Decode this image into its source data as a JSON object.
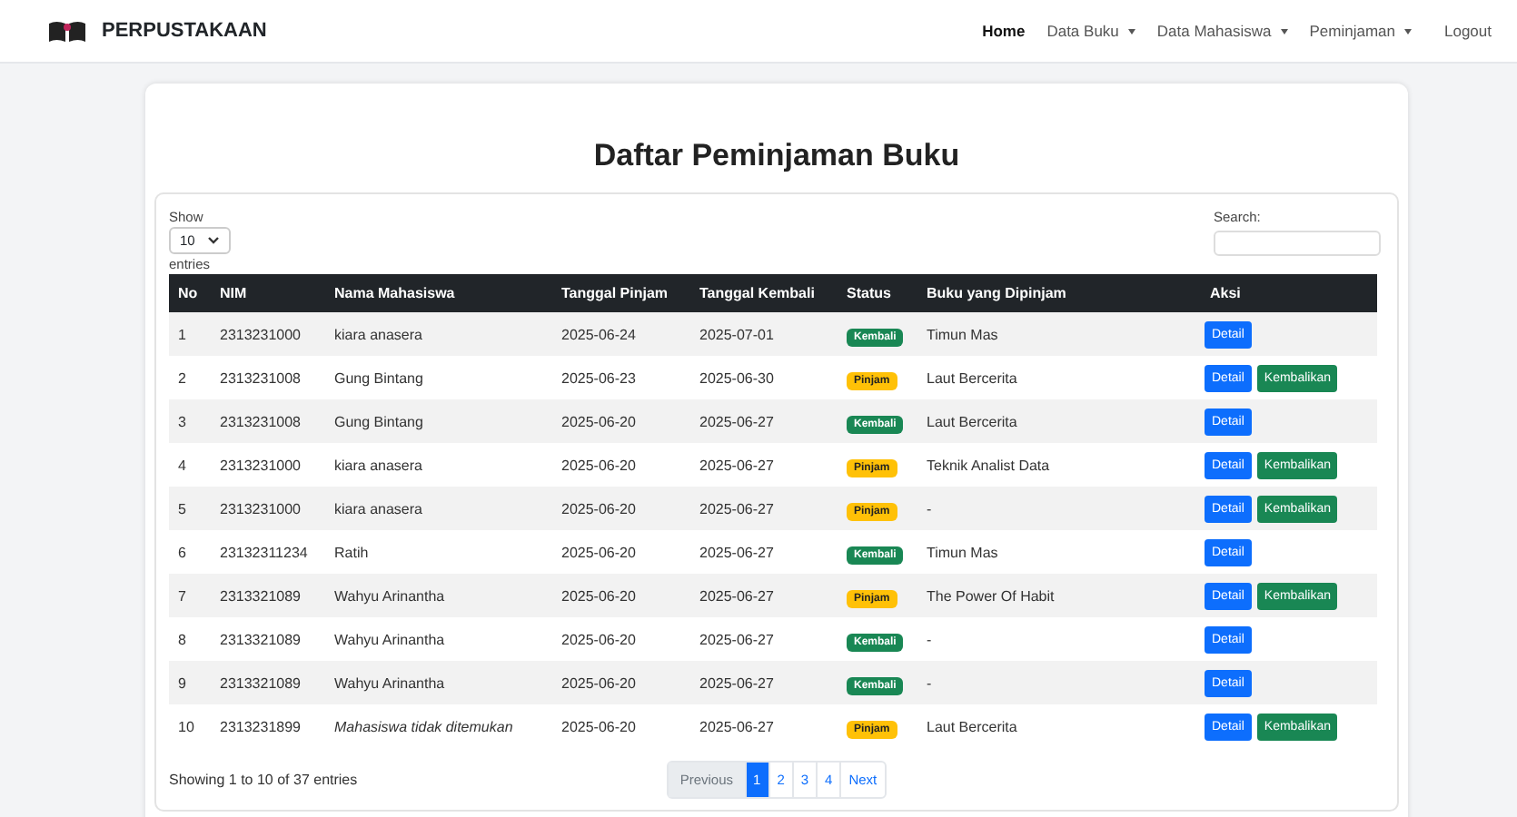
{
  "navbar": {
    "brand": "PERPUSTAKAAN",
    "items": [
      {
        "label": "Home",
        "selected": true,
        "dropdown": false
      },
      {
        "label": "Data Buku",
        "selected": false,
        "dropdown": true
      },
      {
        "label": "Data Mahasiswa",
        "selected": false,
        "dropdown": true
      },
      {
        "label": "Peminjaman",
        "selected": false,
        "dropdown": true
      },
      {
        "label": "Logout",
        "selected": false,
        "dropdown": false
      }
    ]
  },
  "title": "Daftar Peminjaman Buku",
  "length_control": {
    "label_before": "Show",
    "value": "10",
    "label_after": "entries"
  },
  "search": {
    "label": "Search:"
  },
  "table": {
    "columns": [
      "No",
      "NIM",
      "Nama Mahasiswa",
      "Tanggal Pinjam",
      "Tanggal Kembali",
      "Status",
      "Buku yang Dipinjam",
      "Aksi"
    ],
    "rows": [
      {
        "no": "1",
        "nim": "2313231000",
        "name": "kiara anasera",
        "name_found": true,
        "borrowed": "2025-06-24",
        "returned": "2025-07-01",
        "status": {
          "label": "Kembali",
          "kind": "returned"
        },
        "book": "Timun Mas",
        "actions": [
          {
            "label": "Detail",
            "kind": "detail"
          }
        ]
      },
      {
        "no": "2",
        "nim": "2313231008",
        "name": "Gung Bintang",
        "name_found": true,
        "borrowed": "2025-06-23",
        "returned": "2025-06-30",
        "status": {
          "label": "Pinjam",
          "kind": "borrowed"
        },
        "book": "Laut Bercerita",
        "actions": [
          {
            "label": "Detail",
            "kind": "detail"
          },
          {
            "label": "Kembalikan",
            "kind": "return"
          }
        ]
      },
      {
        "no": "3",
        "nim": "2313231008",
        "name": "Gung Bintang",
        "name_found": true,
        "borrowed": "2025-06-20",
        "returned": "2025-06-27",
        "status": {
          "label": "Kembali",
          "kind": "returned"
        },
        "book": "Laut Bercerita",
        "actions": [
          {
            "label": "Detail",
            "kind": "detail"
          }
        ]
      },
      {
        "no": "4",
        "nim": "2313231000",
        "name": "kiara anasera",
        "name_found": true,
        "borrowed": "2025-06-20",
        "returned": "2025-06-27",
        "status": {
          "label": "Pinjam",
          "kind": "borrowed"
        },
        "book": "Teknik Analist Data",
        "actions": [
          {
            "label": "Detail",
            "kind": "detail"
          },
          {
            "label": "Kembalikan",
            "kind": "return"
          }
        ]
      },
      {
        "no": "5",
        "nim": "2313231000",
        "name": "kiara anasera",
        "name_found": true,
        "borrowed": "2025-06-20",
        "returned": "2025-06-27",
        "status": {
          "label": "Pinjam",
          "kind": "borrowed"
        },
        "book": "-",
        "actions": [
          {
            "label": "Detail",
            "kind": "detail"
          },
          {
            "label": "Kembalikan",
            "kind": "return"
          }
        ]
      },
      {
        "no": "6",
        "nim": "23132311234",
        "name": "Ratih",
        "name_found": true,
        "borrowed": "2025-06-20",
        "returned": "2025-06-27",
        "status": {
          "label": "Kembali",
          "kind": "returned"
        },
        "book": "Timun Mas",
        "actions": [
          {
            "label": "Detail",
            "kind": "detail"
          }
        ]
      },
      {
        "no": "7",
        "nim": "2313321089",
        "name": "Wahyu Arinantha",
        "name_found": true,
        "borrowed": "2025-06-20",
        "returned": "2025-06-27",
        "status": {
          "label": "Pinjam",
          "kind": "borrowed"
        },
        "book": "The Power Of Habit",
        "actions": [
          {
            "label": "Detail",
            "kind": "detail"
          },
          {
            "label": "Kembalikan",
            "kind": "return"
          }
        ]
      },
      {
        "no": "8",
        "nim": "2313321089",
        "name": "Wahyu Arinantha",
        "name_found": true,
        "borrowed": "2025-06-20",
        "returned": "2025-06-27",
        "status": {
          "label": "Kembali",
          "kind": "returned"
        },
        "book": "-",
        "actions": [
          {
            "label": "Detail",
            "kind": "detail"
          }
        ]
      },
      {
        "no": "9",
        "nim": "2313321089",
        "name": "Wahyu Arinantha",
        "name_found": true,
        "borrowed": "2025-06-20",
        "returned": "2025-06-27",
        "status": {
          "label": "Kembali",
          "kind": "returned"
        },
        "book": "-",
        "actions": [
          {
            "label": "Detail",
            "kind": "detail"
          }
        ]
      },
      {
        "no": "10",
        "nim": "2313231899",
        "name": "Mahasiswa tidak ditemukan",
        "name_found": false,
        "borrowed": "2025-06-20",
        "returned": "2025-06-27",
        "status": {
          "label": "Pinjam",
          "kind": "borrowed"
        },
        "book": "Laut Bercerita",
        "actions": [
          {
            "label": "Detail",
            "kind": "detail"
          },
          {
            "label": "Kembalikan",
            "kind": "return"
          }
        ]
      }
    ]
  },
  "info": "Showing 1 to 10 of 37 entries",
  "pagination": [
    {
      "label": "Previous",
      "selected": false,
      "disabled": true
    },
    {
      "label": "1",
      "selected": true,
      "disabled": false
    },
    {
      "label": "2",
      "selected": false,
      "disabled": false
    },
    {
      "label": "3",
      "selected": false,
      "disabled": false
    },
    {
      "label": "4",
      "selected": false,
      "disabled": false
    },
    {
      "label": "Next",
      "selected": false,
      "disabled": false
    }
  ]
}
